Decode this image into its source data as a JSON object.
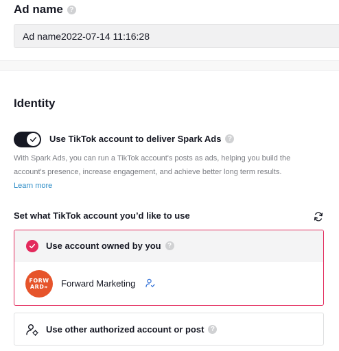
{
  "ad_name": {
    "title": "Ad name",
    "value": "Ad name2022-07-14 11:16:28",
    "help": "?"
  },
  "identity": {
    "title": "Identity",
    "toggle_on": true,
    "toggle_label": "Use TikTok account to deliver Spark Ads",
    "help": "?",
    "description": "With Spark Ads, you can run a TikTok account's posts as ads, helping you build the account's presence, increase engagement, and achieve better long term results.",
    "learn_more": "Learn more"
  },
  "account_select": {
    "title": "Set what TikTok account you’d like to use",
    "refresh_icon": "refresh-icon",
    "owned": {
      "label": "Use account owned by you",
      "selected": true,
      "accent_color": "#e3295c",
      "account": {
        "name": "Forward Marketing",
        "avatar_text_line1": "FORW",
        "avatar_text_line2": "ARD»",
        "avatar_color": "#e6542b",
        "badge_icon": "user-settings-icon"
      }
    },
    "other": {
      "label": "Use other authorized account or post",
      "icon": "user-authorized-icon"
    }
  }
}
